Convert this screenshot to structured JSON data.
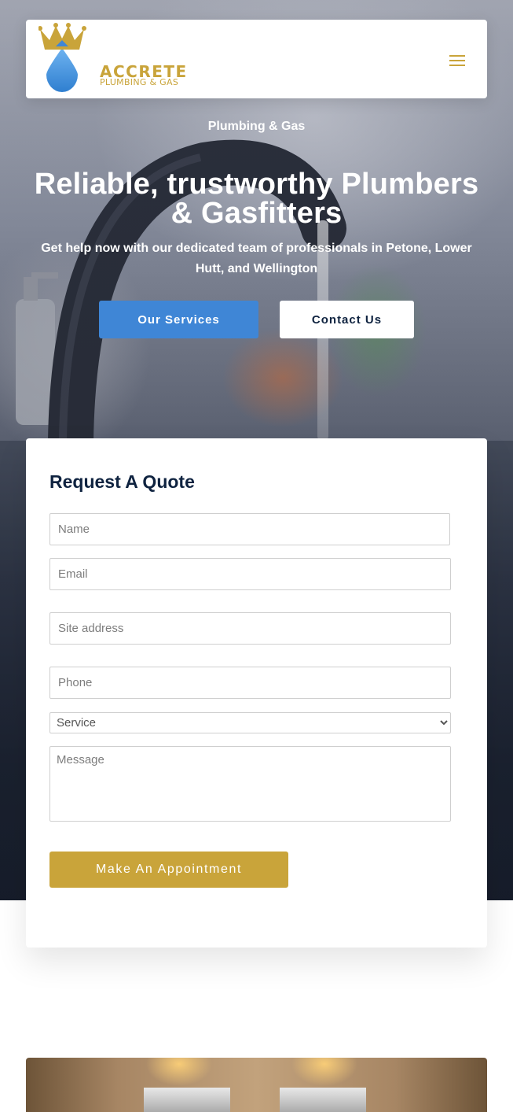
{
  "header": {
    "logo": {
      "wordmark": "ACCRETE",
      "tagline": "PLUMBING & GAS",
      "colors": {
        "gold": "#c9a43a",
        "blue": "#3f86d6"
      }
    },
    "menu_icon": "hamburger-menu-icon"
  },
  "hero": {
    "eyebrow": "Plumbing & Gas",
    "headline": "Reliable, trustworthy Plumbers & Gasfitters",
    "subheadline": "Get help now with our dedicated team of professionals in Petone, Lower Hutt, and Wellington",
    "buttons": {
      "services": "Our Services",
      "contact": "Contact Us"
    }
  },
  "quote_form": {
    "title": "Request A Quote",
    "fields": {
      "name": {
        "placeholder": "Name",
        "value": ""
      },
      "email": {
        "placeholder": "Email",
        "value": ""
      },
      "site_address": {
        "placeholder": "Site address",
        "value": ""
      },
      "phone": {
        "placeholder": "Phone",
        "value": ""
      },
      "service": {
        "selected": "Service"
      },
      "message": {
        "placeholder": "Message",
        "value": ""
      }
    },
    "submit_label": "Make An Appointment"
  },
  "colors": {
    "primary_blue": "#3f86d6",
    "gold": "#c9a43a",
    "navy": "#0f2340",
    "white": "#ffffff"
  }
}
